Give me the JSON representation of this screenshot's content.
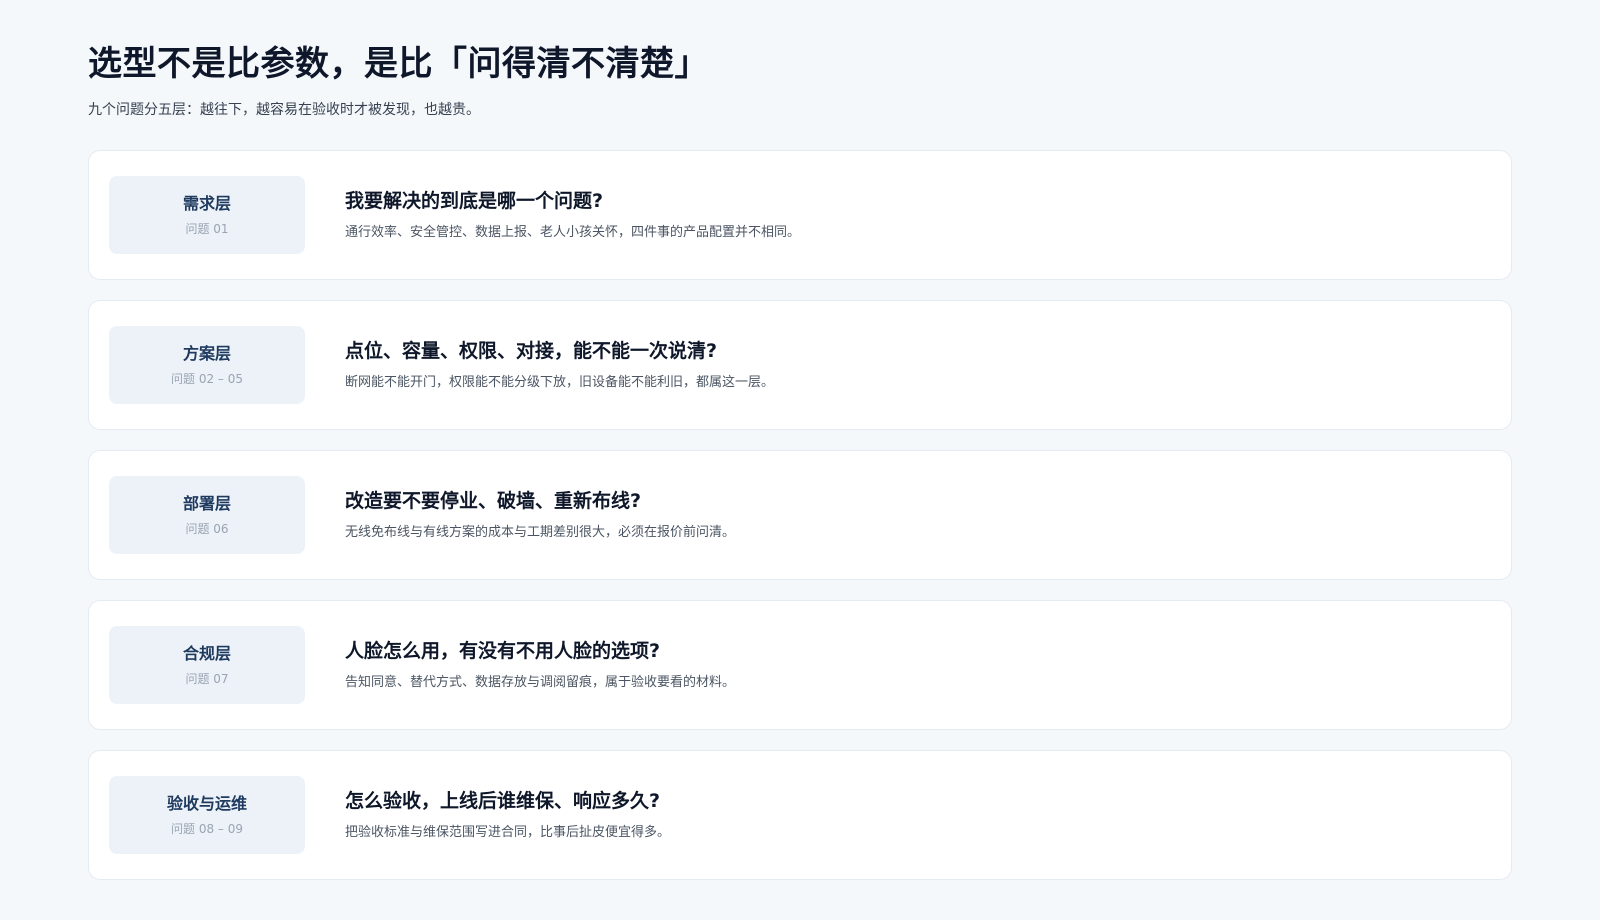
{
  "header": {
    "title": "选型不是比参数，是比「问得清不清楚」",
    "subtitle": "九个问题分五层：越往下，越容易在验收时才被发现，也越贵。"
  },
  "layers": [
    {
      "name": "需求层",
      "range": "问题 01",
      "question": "我要解决的到底是哪一个问题?",
      "note": "通行效率、安全管控、数据上报、老人小孩关怀，四件事的产品配置并不相同。"
    },
    {
      "name": "方案层",
      "range": "问题 02 – 05",
      "question": "点位、容量、权限、对接，能不能一次说清?",
      "note": "断网能不能开门，权限能不能分级下放，旧设备能不能利旧，都属这一层。"
    },
    {
      "name": "部署层",
      "range": "问题 06",
      "question": "改造要不要停业、破墙、重新布线?",
      "note": "无线免布线与有线方案的成本与工期差别很大，必须在报价前问清。"
    },
    {
      "name": "合规层",
      "range": "问题 07",
      "question": "人脸怎么用，有没有不用人脸的选项?",
      "note": "告知同意、替代方式、数据存放与调阅留痕，属于验收要看的材料。"
    },
    {
      "name": "验收与运维",
      "range": "问题 08 – 09",
      "question": "怎么验收，上线后谁维保、响应多久?",
      "note": "把验收标准与维保范围写进合同，比事后扯皮便宜得多。"
    }
  ]
}
